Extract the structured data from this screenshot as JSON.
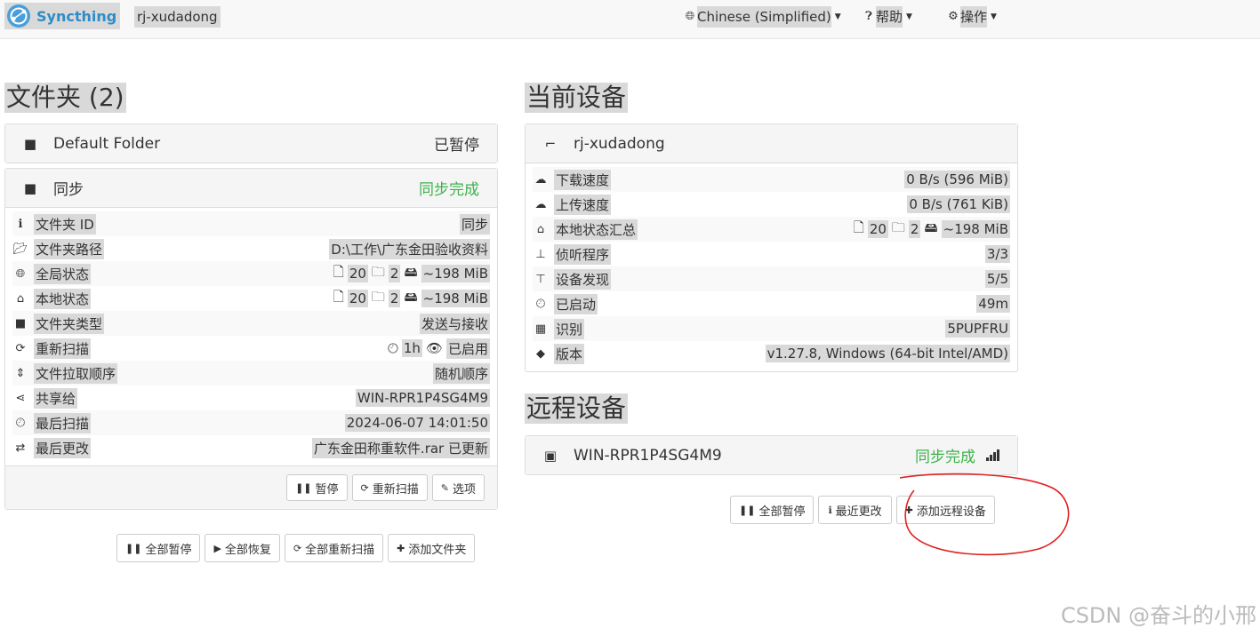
{
  "navbar": {
    "brand": "Syncthing",
    "device_name": "rj-xudadong",
    "language": "Chinese (Simplified)",
    "help": "帮助",
    "actions": "操作"
  },
  "folders": {
    "heading": "文件夹 (2)",
    "default_folder": {
      "name": "Default Folder",
      "status": "已暂停"
    },
    "sync_folder": {
      "name": "同步",
      "status": "同步完成",
      "rows": [
        {
          "icon": "info-icon",
          "label": "文件夹 ID",
          "value": "同步"
        },
        {
          "icon": "folder-open-icon",
          "label": "文件夹路径",
          "value": "D:\\工作\\广东金田验收资料"
        },
        {
          "icon": "globe-icon",
          "label": "全局状态",
          "files": "20",
          "dirs": "2",
          "size": "~198 MiB"
        },
        {
          "icon": "home-icon",
          "label": "本地状态",
          "files": "20",
          "dirs": "2",
          "size": "~198 MiB"
        },
        {
          "icon": "folder-icon",
          "label": "文件夹类型",
          "value": "发送与接收"
        },
        {
          "icon": "refresh-icon",
          "label": "重新扫描",
          "interval": "1h",
          "watch": "已启用"
        },
        {
          "icon": "sort-icon",
          "label": "文件拉取顺序",
          "value": "随机顺序"
        },
        {
          "icon": "share-icon",
          "label": "共享给",
          "value": "WIN-RPR1P4SG4M9"
        },
        {
          "icon": "clock-icon",
          "label": "最后扫描",
          "value": "2024-06-07 14:01:50"
        },
        {
          "icon": "exchange-icon",
          "label": "最后更改",
          "value": "广东金田称重软件.rar 已更新"
        }
      ],
      "buttons": {
        "pause": "暂停",
        "rescan": "重新扫描",
        "options": "选项"
      }
    },
    "bottom_buttons": {
      "pause_all": "全部暂停",
      "resume_all": "全部恢复",
      "rescan_all": "全部重新扫描",
      "add_folder": "添加文件夹"
    }
  },
  "this_device": {
    "heading": "当前设备",
    "name": "rj-xudadong",
    "rows": [
      {
        "icon": "cloud-download-icon",
        "label": "下载速度",
        "value": "0 B/s (596 MiB)"
      },
      {
        "icon": "cloud-upload-icon",
        "label": "上传速度",
        "value": "0 B/s (761 KiB)"
      },
      {
        "icon": "home-icon",
        "label": "本地状态汇总",
        "files": "20",
        "dirs": "2",
        "size": "~198 MiB"
      },
      {
        "icon": "sitemap-icon",
        "label": "侦听程序",
        "value": "3/3"
      },
      {
        "icon": "signpost-icon",
        "label": "设备发现",
        "value": "5/5"
      },
      {
        "icon": "clock-icon",
        "label": "已启动",
        "value": "49m"
      },
      {
        "icon": "qrcode-icon",
        "label": "识别",
        "value": "5PUPFRU"
      },
      {
        "icon": "tag-icon",
        "label": "版本",
        "value": "v1.27.8, Windows (64-bit Intel/AMD)"
      }
    ]
  },
  "remote_devices": {
    "heading": "远程设备",
    "device": {
      "name": "WIN-RPR1P4SG4M9",
      "status": "同步完成"
    },
    "buttons": {
      "pause_all": "全部暂停",
      "recent_changes": "最近更改",
      "add_device": "添加远程设备"
    }
  },
  "watermark": "CSDN @奋斗的小邢",
  "colors": {
    "accent": "#2e8dc8",
    "ok": "#3cb34a",
    "annotation": "#e02020"
  }
}
